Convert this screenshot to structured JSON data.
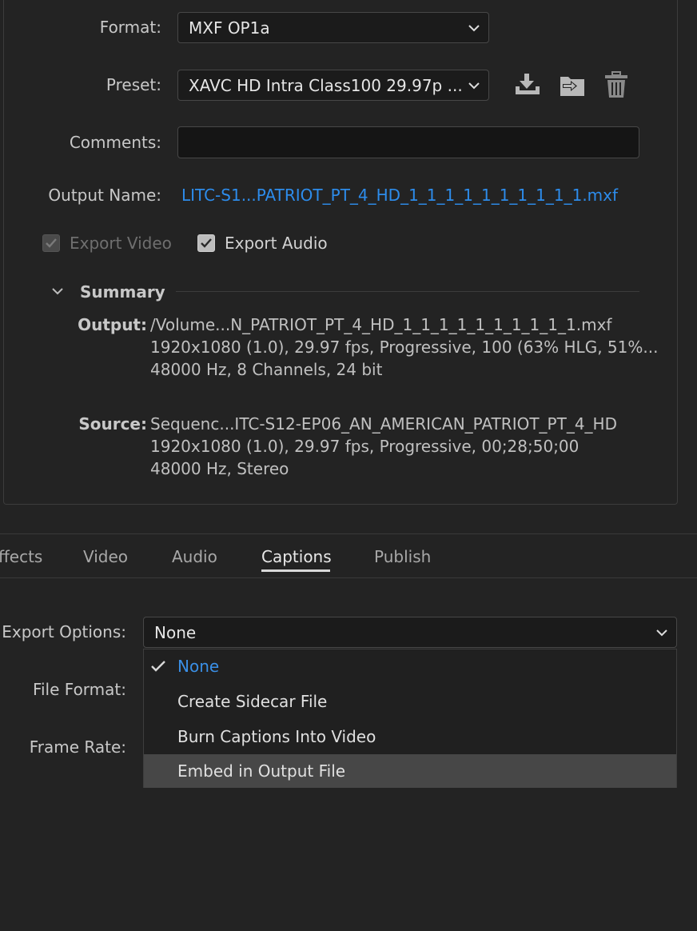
{
  "format": {
    "label": "Format:",
    "value": "MXF OP1a"
  },
  "preset": {
    "label": "Preset:",
    "value": "XAVC HD Intra Class100 29.97p ..."
  },
  "preset_actions": {
    "import_icon": "import-preset-icon",
    "export_icon": "export-preset-icon",
    "delete_icon": "trash-icon"
  },
  "comments": {
    "label": "Comments:",
    "value": ""
  },
  "output_name": {
    "label": "Output Name:",
    "value": "LITC-S1...PATRIOT_PT_4_HD_1_1_1_1_1_1_1_1_1_1.mxf"
  },
  "export_video": {
    "label": "Export Video",
    "checked": true,
    "disabled": true
  },
  "export_audio": {
    "label": "Export Audio",
    "checked": true,
    "disabled": false
  },
  "summary": {
    "title": "Summary",
    "output": {
      "key": "Output:",
      "lines": [
        "/Volume...N_PATRIOT_PT_4_HD_1_1_1_1_1_1_1_1_1_1.mxf",
        "1920x1080 (1.0), 29.97 fps, Progressive, 100 (63% HLG, 51%...",
        "48000 Hz, 8 Channels, 24 bit"
      ]
    },
    "source": {
      "key": "Source:",
      "lines": [
        "Sequenc...ITC-S12-EP06_AN_AMERICAN_PATRIOT_PT_4_HD",
        "1920x1080 (1.0), 29.97 fps, Progressive, 00;28;50;00",
        "48000 Hz, Stereo"
      ]
    }
  },
  "tabs": [
    "ffects",
    "Video",
    "Audio",
    "Captions",
    "Publish"
  ],
  "active_tab": "Captions",
  "captions": {
    "export_options": {
      "label": "Export Options:",
      "value": "None"
    },
    "file_format_label": "File Format:",
    "frame_rate_label": "Frame Rate:",
    "menu": [
      {
        "label": "None",
        "selected": true
      },
      {
        "label": "Create Sidecar File"
      },
      {
        "label": "Burn Captions Into Video"
      },
      {
        "label": "Embed in Output File",
        "hovered": true
      }
    ]
  },
  "colors": {
    "background": "#232323",
    "link_blue": "#2d8ceb",
    "selected_blue": "#3a8fe6",
    "hover_row": "#474747"
  }
}
